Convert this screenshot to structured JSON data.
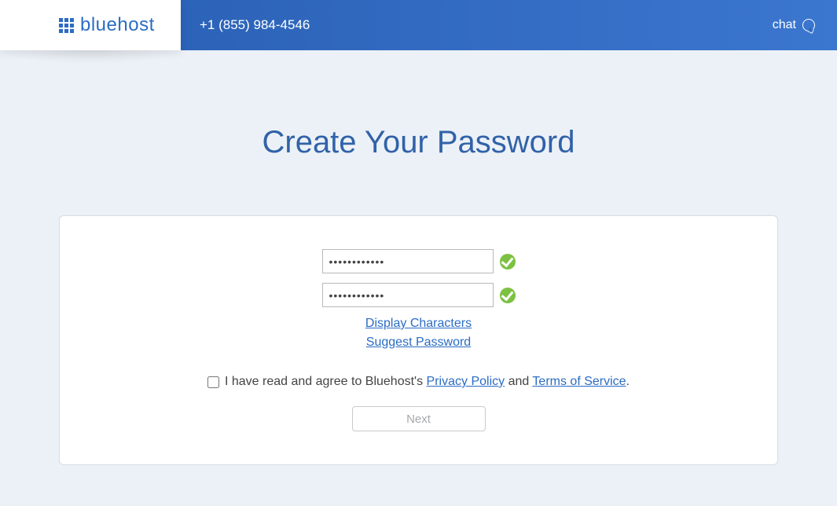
{
  "header": {
    "brand": "bluehost",
    "phone": "+1 (855) 984-4546",
    "chat_label": "chat"
  },
  "page": {
    "title": "Create Your Password"
  },
  "form": {
    "password_value": "••••••••••••",
    "confirm_value": "••••••••••••",
    "display_chars_link": "Display Characters",
    "suggest_pw_link": "Suggest Password",
    "agree_prefix": "I have read and agree to Bluehost's ",
    "privacy_link": "Privacy Policy",
    "agree_mid": " and ",
    "terms_link": "Terms of Service",
    "agree_suffix": ".",
    "next_button": "Next"
  }
}
